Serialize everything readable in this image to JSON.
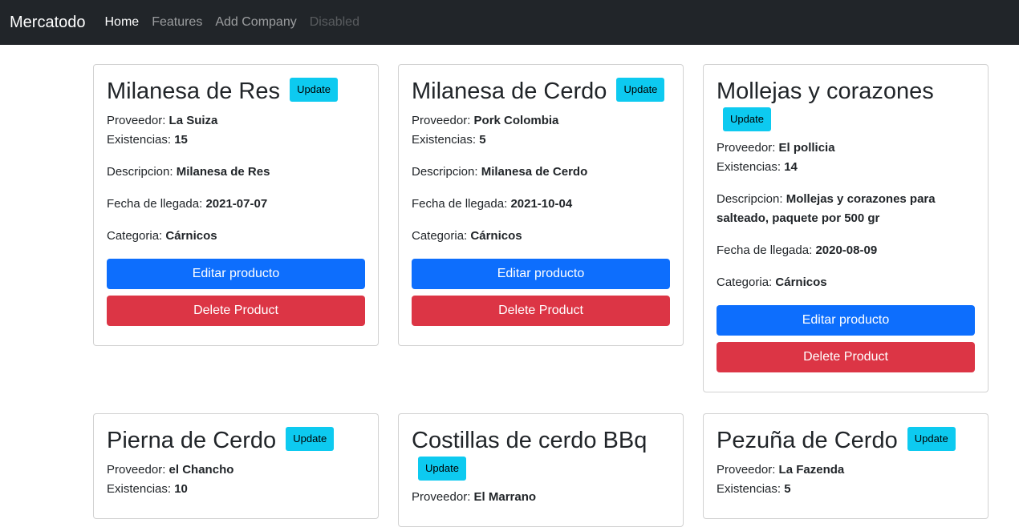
{
  "navbar": {
    "brand": "Mercatodo",
    "links": [
      {
        "label": "Home"
      },
      {
        "label": "Features"
      },
      {
        "label": "Add Company"
      },
      {
        "label": "Disabled"
      }
    ]
  },
  "labels": {
    "proveedor": "Proveedor:",
    "existencias": "Existencias:",
    "descripcion": "Descripcion:",
    "fecha": "Fecha de llegada:",
    "categoria": "Categoria:",
    "update": "Update",
    "edit": "Editar producto",
    "delete": "Delete Product"
  },
  "products": [
    {
      "name": "Milanesa de Res",
      "proveedor": "La Suiza",
      "existencias": "15",
      "descripcion": "Milanesa de Res",
      "fecha": "2021-07-07",
      "categoria": "Cárnicos"
    },
    {
      "name": "Milanesa de Cerdo",
      "proveedor": "Pork Colombia",
      "existencias": "5",
      "descripcion": "Milanesa de Cerdo",
      "fecha": "2021-10-04",
      "categoria": "Cárnicos"
    },
    {
      "name": "Mollejas y corazones",
      "proveedor": "El pollicia",
      "existencias": "14",
      "descripcion": "Mollejas y corazones para salteado, paquete por 500 gr",
      "fecha": "2020-08-09",
      "categoria": "Cárnicos"
    },
    {
      "name": "Pierna de Cerdo",
      "proveedor": "el Chancho",
      "existencias": "10"
    },
    {
      "name": "Costillas de cerdo BBq",
      "proveedor": "El Marrano"
    },
    {
      "name": "Pezuña de Cerdo",
      "proveedor": "La Fazenda",
      "existencias": "5"
    }
  ],
  "colors": {
    "navbar_bg": "#212529",
    "update_bg": "#0dcaf0",
    "edit_bg": "#0d6efd",
    "delete_bg": "#dc3545"
  }
}
